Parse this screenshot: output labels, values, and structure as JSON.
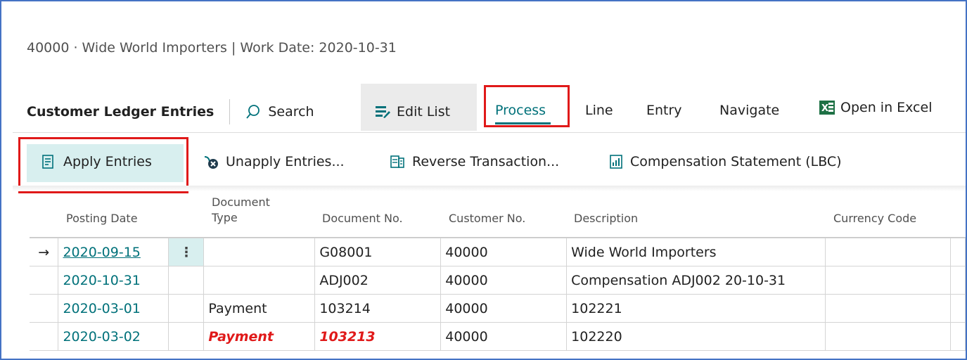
{
  "page": {
    "title": "40000 · Wide World Importers | Work Date: 2020-10-31"
  },
  "action_bar": {
    "caption": "Customer Ledger Entries",
    "search_label": "Search",
    "edit_list_label": "Edit List",
    "menus": [
      "Process",
      "Line",
      "Entry",
      "Navigate"
    ],
    "open_in_excel_label": "Open in Excel"
  },
  "process_actions": {
    "apply_entries": "Apply Entries",
    "unapply_entries": "Unapply Entries...",
    "reverse_transaction": "Reverse Transaction...",
    "compensation_statement": "Compensation Statement (LBC)"
  },
  "table": {
    "headers": {
      "posting_date": "Posting Date",
      "document_type_1": "Document",
      "document_type_2": "Type",
      "document_no": "Document No.",
      "customer_no": "Customer No.",
      "description": "Description",
      "currency_code": "Currency Code"
    },
    "rows": [
      {
        "posting_date": "2020-09-15",
        "document_type": "",
        "document_no": "G08001",
        "customer_no": "40000",
        "description": "Wide World Importers",
        "currency_code": ""
      },
      {
        "posting_date": "2020-10-31",
        "document_type": "",
        "document_no": "ADJ002",
        "customer_no": "40000",
        "description": "Compensation ADJ002 20-10-31",
        "currency_code": ""
      },
      {
        "posting_date": "2020-03-01",
        "document_type": "Payment",
        "document_no": "103214",
        "customer_no": "40000",
        "description": "102221",
        "currency_code": ""
      },
      {
        "posting_date": "2020-03-02",
        "document_type": "Payment",
        "document_no": "103213",
        "customer_no": "40000",
        "description": "102220",
        "currency_code": ""
      }
    ],
    "row_marker": "→",
    "row_menu": "⋮"
  },
  "colors": {
    "accent": "#00717a",
    "highlight_red": "#e01919",
    "selected_bg": "#d8efef",
    "frame_border": "#4472c4"
  }
}
